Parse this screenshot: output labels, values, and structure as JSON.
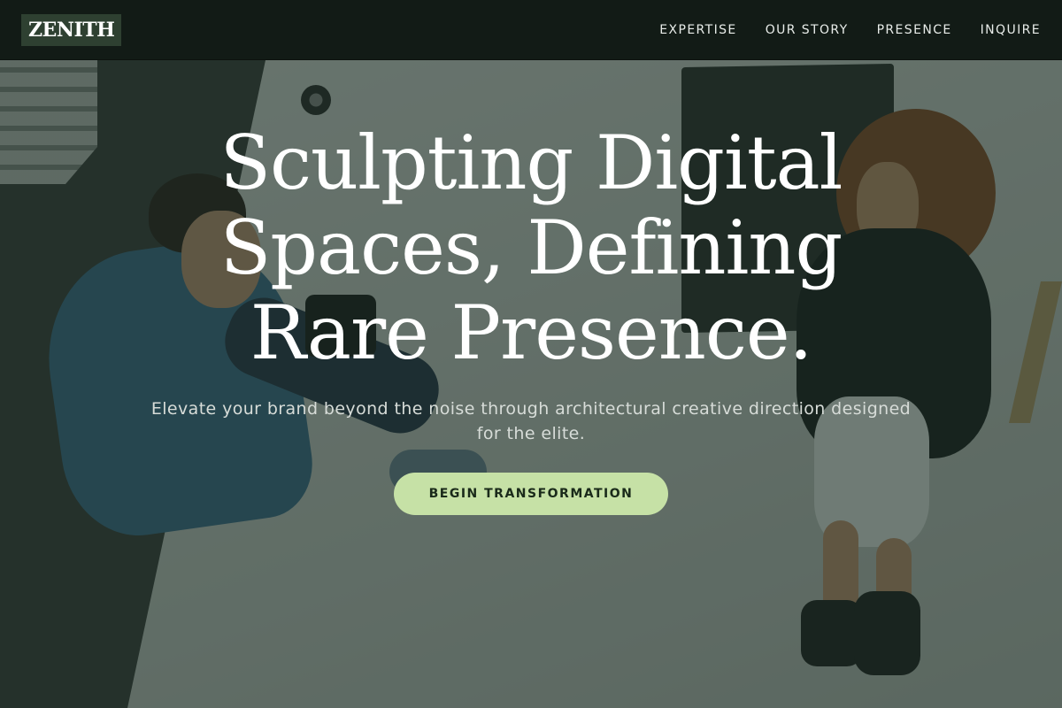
{
  "header": {
    "logo": "ZENITH",
    "nav": [
      {
        "label": "EXPERTISE"
      },
      {
        "label": "OUR STORY"
      },
      {
        "label": "PRESENCE"
      },
      {
        "label": "INQUIRE"
      }
    ]
  },
  "hero": {
    "headline": "Sculpting Digital Spaces, Defining Rare Presence.",
    "subheadline": "Elevate your brand beyond the noise through architectural creative direction designed for the elite.",
    "cta_label": "BEGIN TRANSFORMATION"
  },
  "colors": {
    "header_bg": "#121b16",
    "logo_bg": "#2e4031",
    "overlay": "#162a20",
    "cta_bg": "#c6e1a6",
    "cta_text": "#1a2a1a"
  }
}
